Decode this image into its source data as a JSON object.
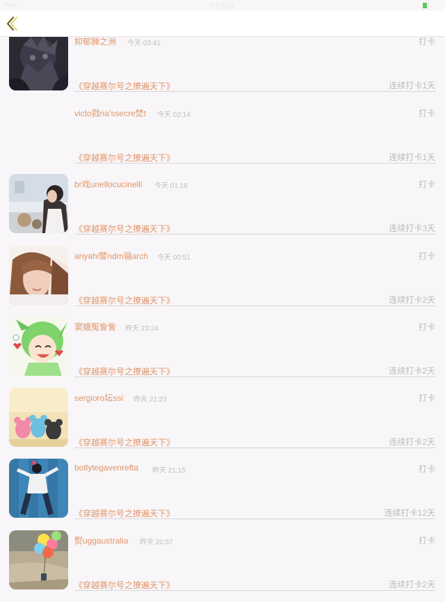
{
  "status_bar": {
    "carrier": "iPad",
    "time": "下午3:13",
    "battery_color": "#5ac85a"
  },
  "nav": {
    "back_icon": "chevron-left-icon",
    "back_color": "#6b6b1e"
  },
  "colors": {
    "accent": "#e0966a",
    "muted": "#bcbabc",
    "background": "#f8f6f8"
  },
  "feed": [
    {
      "username": "抑郁狮之洲",
      "time": "今天 03:41",
      "action": "打卡",
      "book": "《穿越赛尔号之撩遍天下》",
      "streak": "连续打卡1天",
      "avatar": "dark-monster"
    },
    {
      "username": "victo戮ria'ssecre焚t",
      "time": "今天 02:14",
      "action": "打卡",
      "book": "《穿越赛尔号之撩遍天下》",
      "streak": "连续打卡1天",
      "avatar": "none"
    },
    {
      "username": "br戏unellocucinelli",
      "time": "今天 01:18",
      "action": "打卡",
      "book": "《穿越赛尔号之撩遍天下》",
      "streak": "连续打卡3天",
      "avatar": "girl-table"
    },
    {
      "username": "anyahi譬ndm骊arch",
      "time": "今天 00:51",
      "action": "打卡",
      "book": "《穿越赛尔号之撩遍天下》",
      "streak": "连续打卡2天",
      "avatar": "girl-face"
    },
    {
      "username": "窦娥冤訾訾",
      "time": "昨天 23:24",
      "action": "打卡",
      "book": "《穿越赛尔号之撩遍天下》",
      "streak": "连续打卡2天",
      "avatar": "anime-green"
    },
    {
      "username": "sergioro坛ssi",
      "time": "昨天 21:23",
      "action": "打卡",
      "book": "《穿越赛尔号之撩遍天下》",
      "streak": "连续打卡2天",
      "avatar": "toy-mice"
    },
    {
      "username": "botlytegavenrefta",
      "time": "昨天 21:15",
      "action": "打卡",
      "book": "《穿越赛尔号之撩遍天下》",
      "streak": "连续打卡12天",
      "avatar": "person-blue-wall"
    },
    {
      "username": "熨uggaustralia",
      "time": "昨天 20:57",
      "action": "打卡",
      "book": "《穿越赛尔号之撩遍天下》",
      "streak": "连续打卡2天",
      "avatar": "balloons-beach"
    }
  ]
}
